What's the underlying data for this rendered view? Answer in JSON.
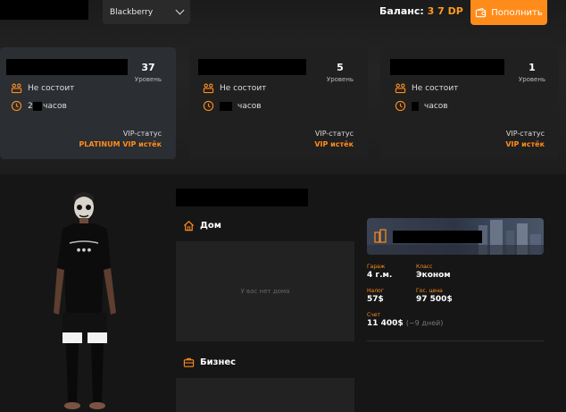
{
  "header": {
    "server": "Blackberry",
    "balance_label": "Баланс:",
    "balance_value": "3  7 DP",
    "topup_label": "Пополнить"
  },
  "cards": [
    {
      "level": "37",
      "level_label": "Уровень",
      "family": "Не состоит",
      "hours": "2   7 часов",
      "vip_label": "VIP-статус",
      "vip_status": "PLATINUM VIP истёк"
    },
    {
      "level": "5",
      "level_label": "Уровень",
      "family": "Не состоит",
      "hours": "часов",
      "vip_label": "VIP-статус",
      "vip_status": "VIP истёк"
    },
    {
      "level": "1",
      "level_label": "Уровень",
      "family": "Не состоит",
      "hours": "часов",
      "vip_label": "VIP-статус",
      "vip_status": "VIP истёк"
    }
  ],
  "house": {
    "title": "Дом",
    "empty": "У вас нет дома"
  },
  "business": {
    "title": "Бизнес"
  },
  "property": {
    "garage_label": "Гараж",
    "garage_value": "4 г.м.",
    "class_label": "Класс",
    "class_value": "Эконом",
    "tax_label": "Налог",
    "tax_value": "57$",
    "price_label": "Гос. цена",
    "price_value": "97 500$",
    "account_label": "Счет",
    "account_value": "11 400$",
    "account_note": "(−9 дней)"
  },
  "colors": {
    "accent": "#ff8c1a",
    "bg": "#141414",
    "card": "#202020"
  }
}
